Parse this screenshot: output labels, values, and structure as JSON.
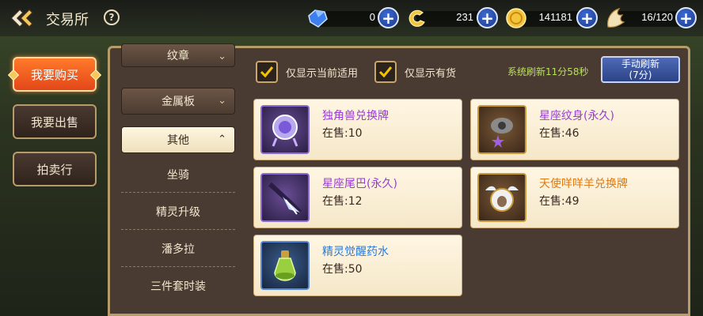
{
  "header": {
    "title": "交易所",
    "help": "?"
  },
  "currencies": [
    {
      "icon": "blue-gem-icon",
      "value": "0"
    },
    {
      "icon": "gold-swirl-icon",
      "value": "231"
    },
    {
      "icon": "gold-coin-icon",
      "value": "141181"
    },
    {
      "icon": "wing-icon",
      "value": "16/120"
    }
  ],
  "plus": "+",
  "left_menu": [
    {
      "label": "我要购买",
      "active": true
    },
    {
      "label": "我要出售",
      "active": false
    },
    {
      "label": "拍卖行",
      "active": false
    }
  ],
  "categories": {
    "top": [
      "纹章",
      "金属板"
    ],
    "selected": "其他",
    "sub": [
      "坐骑",
      "精灵升级",
      "潘多拉",
      "三件套时装"
    ]
  },
  "filters": {
    "only_applicable": {
      "label": "仅显示当前适用",
      "checked": true
    },
    "only_in_stock": {
      "label": "仅显示有货",
      "checked": true
    }
  },
  "refresh": {
    "timer_text": "系统刷新11分58秒",
    "button_line1": "手动刷新",
    "button_line2": "(7分)"
  },
  "items": [
    {
      "name": "独角兽兑换牌",
      "stock": "在售:10",
      "icon": "unicorn-badge-icon",
      "color": "purple"
    },
    {
      "name": "星座纹身(永久)",
      "stock": "在售:46",
      "icon": "constellation-tattoo-icon",
      "color": "purple"
    },
    {
      "name": "星座尾巴(永久)",
      "stock": "在售:12",
      "icon": "constellation-tail-icon",
      "color": "purple"
    },
    {
      "name": "天使咩咩羊兑换牌",
      "stock": "在售:49",
      "icon": "angel-sheep-badge-icon",
      "color": "orange"
    },
    {
      "name": "精灵觉醒药水",
      "stock": "在售:50",
      "icon": "potion-icon",
      "color": "blue"
    }
  ]
}
